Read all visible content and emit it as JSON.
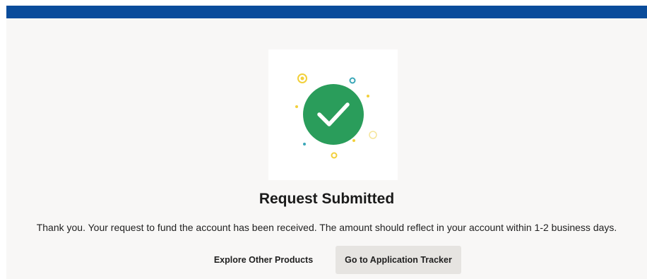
{
  "header": {
    "bar_color": "#0a4c9b"
  },
  "illustration": {
    "icon": "checkmark-success-icon",
    "circle_color": "#2a9d5b",
    "accent_colors": [
      "#f2d03b",
      "#3aa7b8"
    ]
  },
  "confirmation": {
    "title": "Request Submitted",
    "message": "Thank you. Your request to fund the account has been received. The amount should reflect in your account within 1-2 business days."
  },
  "actions": {
    "explore_label": "Explore Other Products",
    "tracker_label": "Go to Application Tracker"
  }
}
